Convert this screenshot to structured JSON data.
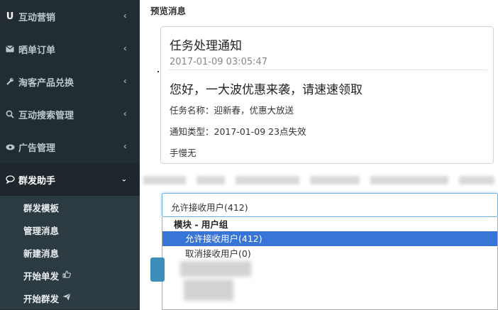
{
  "sidebar": {
    "items": [
      {
        "label": "互动营销",
        "icon": "u-icon"
      },
      {
        "label": "晒单订单",
        "icon": "envelope-icon"
      },
      {
        "label": "淘客产品兑换",
        "icon": "wrench-icon"
      },
      {
        "label": "互动搜索管理",
        "icon": "search-icon"
      },
      {
        "label": "广告管理",
        "icon": "eye-icon"
      },
      {
        "label": "群发助手",
        "icon": "comment-icon",
        "active": true
      }
    ],
    "subitems": [
      {
        "label": "群发模板"
      },
      {
        "label": "管理消息"
      },
      {
        "label": "新建消息"
      },
      {
        "label": "开始单发",
        "icon": "thumbs-up-icon"
      },
      {
        "label": "开始群发",
        "icon": "paper-plane-icon"
      }
    ]
  },
  "preview": {
    "heading": "预览消息",
    "card": {
      "title": "任务处理通知",
      "time": "2017-01-09 03:05:47",
      "greeting": "您好，一大波优惠来袭，请速速领取",
      "task_name": "任务名称：迎新春，优惠大放送",
      "notice_type": "通知类型：2017-01-09 23点失效",
      "remark": "手慢无"
    }
  },
  "select": {
    "value": "允许接收用户(412)",
    "group_label": "模块 - 用户组",
    "options": [
      {
        "label": "允许接收用户(412)",
        "selected": true
      },
      {
        "label": "取消接收用户(0)",
        "selected": false
      }
    ]
  },
  "colors": {
    "sidebar_bg": "#222d32",
    "submenu_bg": "#2c3b41",
    "accent": "#3c8dbc",
    "selected_option": "#3875d7"
  }
}
